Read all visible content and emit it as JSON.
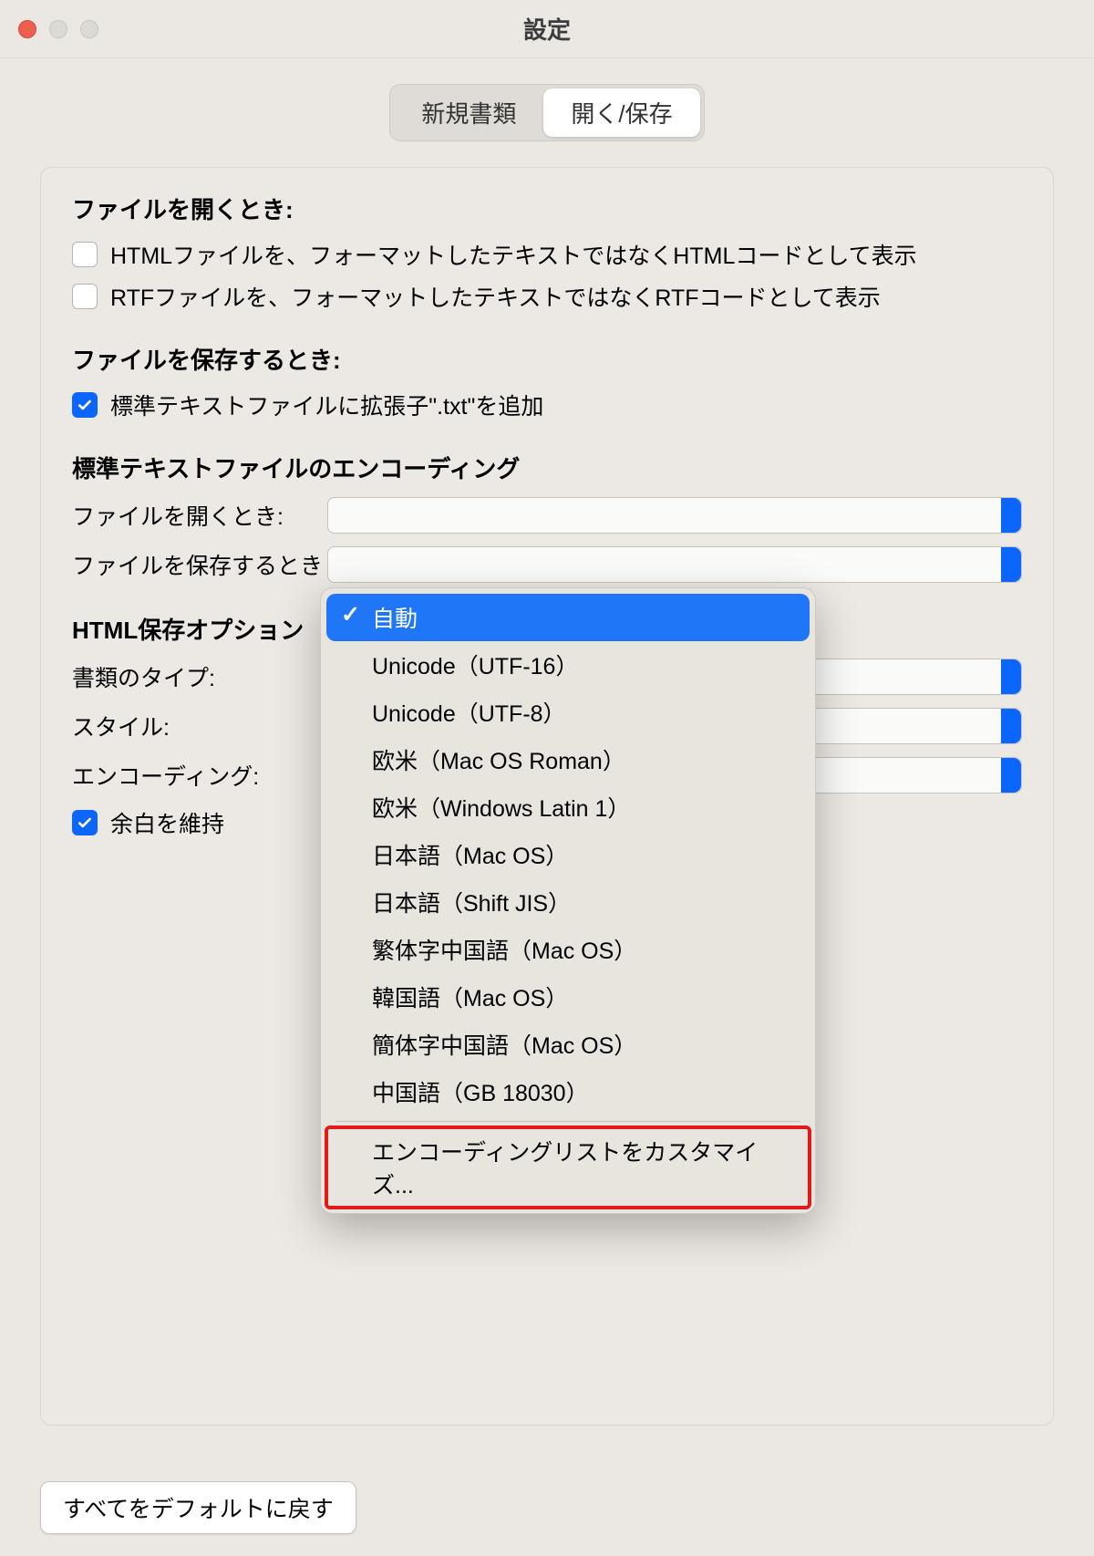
{
  "window": {
    "title": "設定"
  },
  "tabs": {
    "new_doc": "新規書類",
    "open_save": "開く/保存"
  },
  "open_section": {
    "heading": "ファイルを開くとき:",
    "html_code": "HTMLファイルを、フォーマットしたテキストではなくHTMLコードとして表示",
    "rtf_code": "RTFファイルを、フォーマットしたテキストではなくRTFコードとして表示"
  },
  "save_section": {
    "heading": "ファイルを保存するとき:",
    "txt_ext": "標準テキストファイルに拡張子\".txt\"を追加"
  },
  "encoding_section": {
    "heading": "標準テキストファイルのエンコーディング",
    "open_label": "ファイルを開くとき:",
    "save_label": "ファイルを保存するとき"
  },
  "html_section": {
    "heading": "HTML保存オプション",
    "doc_type": "書類のタイプ:",
    "style": "スタイル:",
    "encoding": "エンコーディング:",
    "preserve_margin": "余白を維持"
  },
  "encoding_menu": {
    "items": [
      "自動",
      "Unicode（UTF-16）",
      "Unicode（UTF-8）",
      "欧米（Mac OS Roman）",
      "欧米（Windows Latin 1）",
      "日本語（Mac OS）",
      "日本語（Shift JIS）",
      "繁体字中国語（Mac OS）",
      "韓国語（Mac OS）",
      "簡体字中国語（Mac OS）",
      "中国語（GB 18030）"
    ],
    "customize": "エンコーディングリストをカスタマイズ..."
  },
  "footer": {
    "reset": "すべてをデフォルトに戻す"
  }
}
